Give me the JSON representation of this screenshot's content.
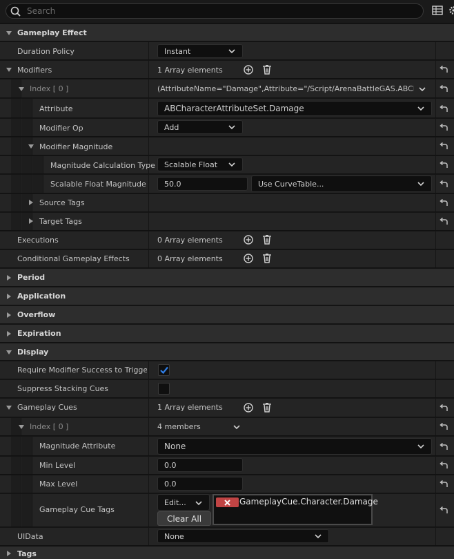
{
  "search": {
    "placeholder": "Search",
    "icon": "search-icon"
  },
  "toolbar": {
    "table_icon": "table-view-icon",
    "settings_icon": "gear-icon"
  },
  "sections": {
    "gameplay_effect": "Gameplay Effect",
    "period": "Period",
    "application": "Application",
    "overflow": "Overflow",
    "expiration": "Expiration",
    "display": "Display",
    "tags": "Tags"
  },
  "props": {
    "duration_policy": {
      "label": "Duration Policy",
      "value": "Instant"
    },
    "modifiers": {
      "label": "Modifiers",
      "value": "1 Array elements"
    },
    "modifier_index": {
      "label": "Index [ 0 ]",
      "value": "(AttributeName=\"Damage\",Attribute=\"/Script/ArenaBattleGAS.ABCharac"
    },
    "attribute": {
      "label": "Attribute",
      "value": "ABCharacterAttributeSet.Damage"
    },
    "modifier_op": {
      "label": "Modifier Op",
      "value": "Add"
    },
    "modifier_magnitude": {
      "label": "Modifier Magnitude"
    },
    "magnitude_calc_type": {
      "label": "Magnitude Calculation Type",
      "value": "Scalable Float"
    },
    "scalable_float_magnitude": {
      "label": "Scalable Float Magnitude",
      "value": "50.0",
      "curve": "Use CurveTable..."
    },
    "source_tags": {
      "label": "Source Tags"
    },
    "target_tags": {
      "label": "Target Tags"
    },
    "executions": {
      "label": "Executions",
      "value": "0 Array elements"
    },
    "conditional_effects": {
      "label": "Conditional Gameplay Effects",
      "value": "0 Array elements"
    },
    "require_modifier_success": {
      "label": "Require Modifier Success to Trigger...",
      "checked": true
    },
    "suppress_stacking_cues": {
      "label": "Suppress Stacking Cues",
      "checked": false
    },
    "gameplay_cues": {
      "label": "Gameplay Cues",
      "value": "1 Array elements"
    },
    "cue_index": {
      "label": "Index [ 0 ]",
      "value": "4 members"
    },
    "magnitude_attribute": {
      "label": "Magnitude Attribute",
      "value": "None"
    },
    "min_level": {
      "label": "Min Level",
      "value": "0.0"
    },
    "max_level": {
      "label": "Max Level",
      "value": "0.0"
    },
    "gameplay_cue_tags": {
      "label": "Gameplay Cue Tags",
      "edit": "Edit...",
      "clear": "Clear All",
      "tag": "GameplayCue.Character.Damage"
    },
    "ui_data": {
      "label": "UIData",
      "value": "None"
    }
  },
  "icons": {
    "add": "add-element-icon",
    "delete": "delete-all-icon",
    "reset": "reset-to-default-icon"
  },
  "colors": {
    "accent_check": "#1a73e8",
    "tag_remove": "#c04444"
  }
}
